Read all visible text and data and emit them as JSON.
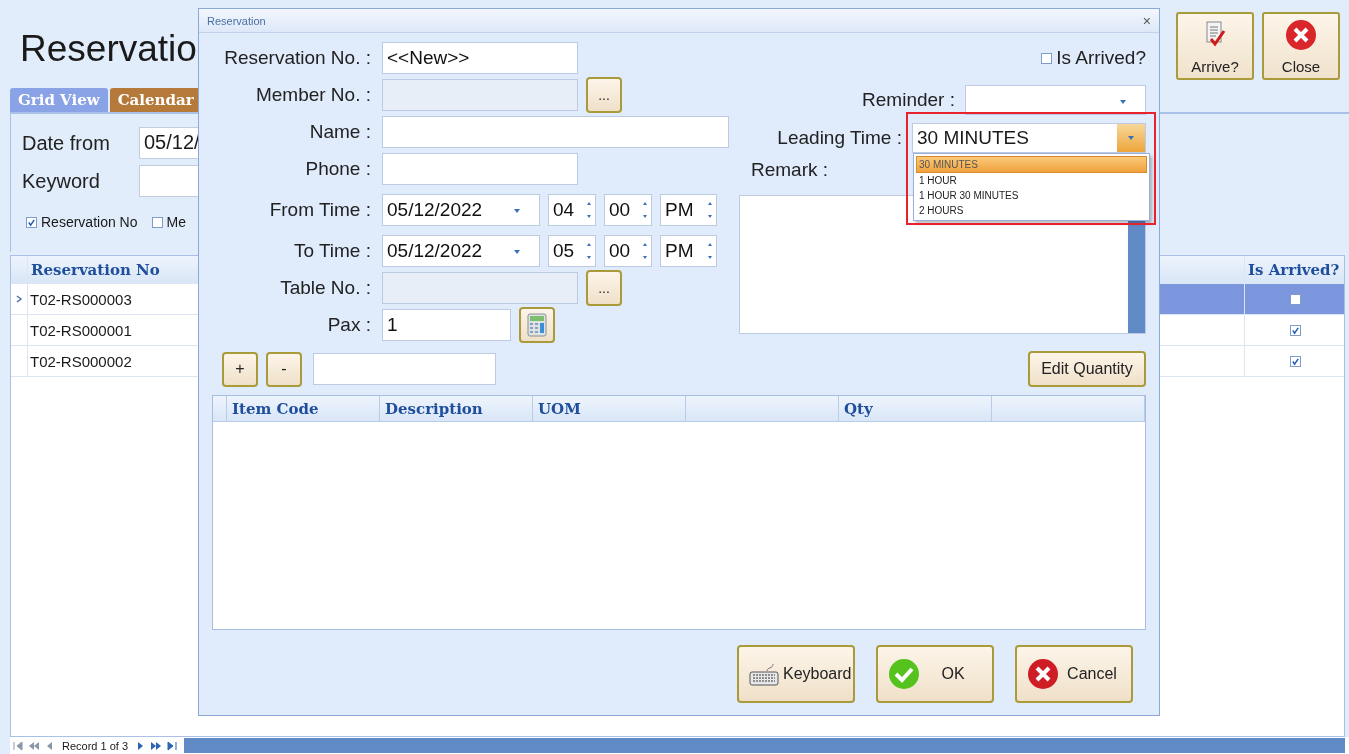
{
  "page": {
    "title": "Reservatio",
    "toolbar": [
      {
        "label": "Arrive?",
        "kind": "arrive"
      },
      {
        "label": "Close",
        "kind": "close"
      }
    ],
    "tabs": [
      {
        "label": "Grid View",
        "selected": true
      },
      {
        "label": "Calendar",
        "selected": false
      }
    ],
    "filters": [
      {
        "label": "Date from",
        "value": "05/12/"
      },
      {
        "label": "Keyword"
      }
    ],
    "search_options": [
      {
        "label": "Reservation No",
        "checked": true
      },
      {
        "label": "Me",
        "checked": false
      }
    ],
    "grid": {
      "columns": [
        {
          "label": "Reservation No"
        },
        {
          "label": "Is Arrived?"
        }
      ],
      "rows": [
        {
          "reservation_no": "T02-RS000003",
          "is_arrived": false,
          "selected": true
        },
        {
          "reservation_no": "T02-RS000001",
          "is_arrived": true,
          "selected": false
        },
        {
          "reservation_no": "T02-RS000002",
          "is_arrived": true,
          "selected": false
        }
      ]
    },
    "navigator": {
      "text": "Record 1 of 3"
    }
  },
  "dialog": {
    "title": "Reservation",
    "close": "×",
    "fields": [
      {
        "label": "Reservation No. :",
        "kind": "text",
        "value": "<<New>>"
      },
      {
        "label": "Member No. :",
        "kind": "lookup",
        "disabled": true,
        "button": "..."
      },
      {
        "label": "Name :",
        "kind": "wide"
      },
      {
        "label": "Phone :",
        "kind": "text"
      },
      {
        "label": "From Time :",
        "kind": "datetime",
        "date": "05/12/2022",
        "hour": "04",
        "minute": "00",
        "ampm": "PM"
      },
      {
        "label": "To Time :",
        "kind": "datetime",
        "date": "05/12/2022",
        "hour": "05",
        "minute": "00",
        "ampm": "PM"
      },
      {
        "label": "Table No. :",
        "kind": "lookup",
        "disabled": true,
        "button": "..."
      },
      {
        "label": "Pax :",
        "kind": "number",
        "value": "1"
      }
    ],
    "is_arrived": {
      "label": "Is Arrived?",
      "checked": false
    },
    "reminder": {
      "label": "Reminder :"
    },
    "leading_time": {
      "label": "Leading Time :",
      "value": "30 MINUTES",
      "expanded": true,
      "highlighted": true,
      "options": [
        {
          "label": "30 MINUTES",
          "selected": true
        },
        {
          "label": "1 HOUR",
          "selected": false
        },
        {
          "label": "1 HOUR 30 MINUTES",
          "selected": false
        },
        {
          "label": "2 HOURS",
          "selected": false
        }
      ]
    },
    "remark": {
      "label": "Remark :"
    },
    "qty_controls": {
      "plus": "+",
      "minus": "-"
    },
    "edit_quantity": "Edit Quantity",
    "items": {
      "columns": [
        {
          "label": "Item Code"
        },
        {
          "label": "Description"
        },
        {
          "label": "UOM"
        },
        {},
        {
          "label": "Qty"
        },
        {}
      ]
    },
    "buttons": [
      {
        "label": "Keyboard",
        "kind": "keyboard"
      },
      {
        "label": "OK",
        "kind": "ok"
      },
      {
        "label": "Cancel",
        "kind": "cancel"
      }
    ]
  }
}
